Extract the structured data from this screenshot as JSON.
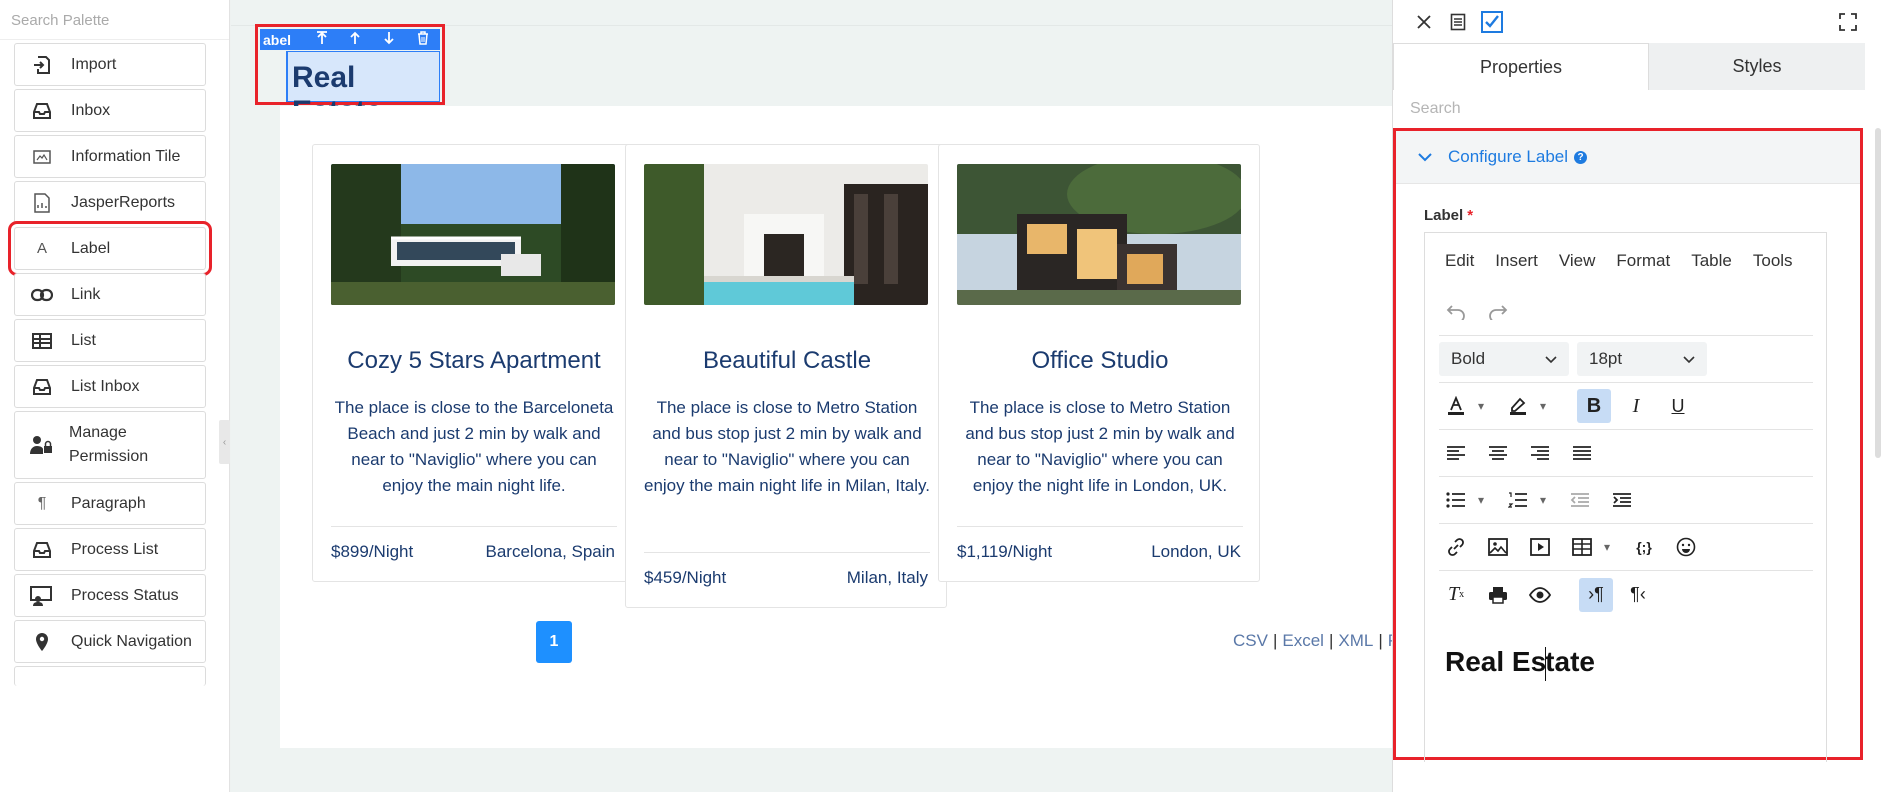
{
  "palette": {
    "search_placeholder": "Search Palette",
    "items": [
      {
        "label": "Import",
        "icon": "import-icon"
      },
      {
        "label": "Inbox",
        "icon": "inbox-icon"
      },
      {
        "label": "Information Tile",
        "icon": "information-tile-icon"
      },
      {
        "label": "JasperReports",
        "icon": "report-icon"
      },
      {
        "label": "Label",
        "icon": "label-icon",
        "selected": true
      },
      {
        "label": "Link",
        "icon": "link-icon"
      },
      {
        "label": "List",
        "icon": "list-icon"
      },
      {
        "label": "List Inbox",
        "icon": "inbox-icon"
      },
      {
        "label": "Manage Permission",
        "icon": "user-lock-icon"
      },
      {
        "label": "Paragraph",
        "icon": "paragraph-icon"
      },
      {
        "label": "Process List",
        "icon": "inbox-icon"
      },
      {
        "label": "Process Status",
        "icon": "process-status-icon"
      },
      {
        "label": "Quick Navigation",
        "icon": "map-pin-icon"
      }
    ]
  },
  "canvas": {
    "label_toolbar": {
      "name": "abel"
    },
    "label_title": "Real Estate",
    "cards": [
      {
        "title": "Cozy 5 Stars Apartment",
        "description": "The place is close to the Barceloneta Beach and just 2 min by walk and near to \"Naviglio\" where you can enjoy the main night life.",
        "price": "$899/Night",
        "location": "Barcelona, Spain"
      },
      {
        "title": "Beautiful Castle",
        "description": "The place is close to Metro Station and bus stop just 2 min by walk and near to \"Naviglio\" where you can enjoy the main night life in Milan, Italy.",
        "price": "$459/Night",
        "location": "Milan, Italy"
      },
      {
        "title": "Office Studio",
        "description": "The place is close to Metro Station and bus stop just 2 min by walk and near to \"Naviglio\" where you can enjoy the night life in London, UK.",
        "price": "$1,119/Night",
        "location": "London, UK"
      }
    ],
    "pagination": {
      "current_page": "1"
    },
    "exports": {
      "csv": "CSV",
      "excel": "Excel",
      "xml": "XML",
      "pdf": "PD"
    }
  },
  "panel": {
    "tabs": {
      "properties": "Properties",
      "styles": "Styles"
    },
    "search_placeholder": "Search",
    "section_title": "Configure Label",
    "field_label": "Label",
    "required_mark": "*",
    "editor": {
      "menu": [
        "Edit",
        "Insert",
        "View",
        "Format",
        "Table",
        "Tools"
      ],
      "font_weight": "Bold",
      "font_size": "18pt",
      "content_before_caret": "Real Es",
      "content_after_caret": "tate"
    }
  },
  "colors": {
    "accent": "#1e90ff",
    "highlight_outline": "#e8222a",
    "title_text": "#1b3b6f",
    "toolbar_blue": "#2d7ef7"
  }
}
